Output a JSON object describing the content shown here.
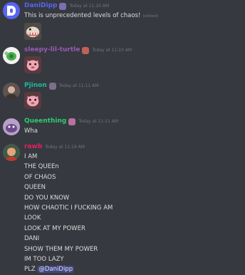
{
  "messages": [
    {
      "author": "DaniDipp",
      "author_color": "#5865f2",
      "timestamp": "Today at 11:10 AM",
      "lines": [
        "This is unprecedented levels of chaos!"
      ],
      "edited": "(edited)",
      "emoji": "dino-emoji"
    },
    {
      "author": "sleepy-lil-turtle",
      "author_color": "#9b59b6",
      "timestamp": "Today at 11:10 AM",
      "emoji": "pig-face-emoji"
    },
    {
      "author": "Pjinon",
      "author_color": "#1abc9c",
      "timestamp": "Today at 11:11 AM",
      "emoji": "pig-face-emoji"
    },
    {
      "author": "Queenthing",
      "author_color": "#2ecc71",
      "timestamp": "Today at 11:11 AM",
      "lines": [
        "Wha"
      ]
    },
    {
      "author": "rawb",
      "author_color": "#e91e63",
      "timestamp": "Today at 11:19 AM",
      "lines": [
        "I AM",
        "THE QUEEn",
        "OF CHAOS",
        "QUEEN",
        "DO YOU KNOW",
        "HOW CHAOTIC I FUCKING AM",
        "LOOK",
        "LOOK AT MY POWER",
        "DANI",
        "SHOW THEM MY POWER",
        "IM TOO LAZY",
        "PLZ"
      ],
      "mention": "@DaniDipp"
    }
  ]
}
